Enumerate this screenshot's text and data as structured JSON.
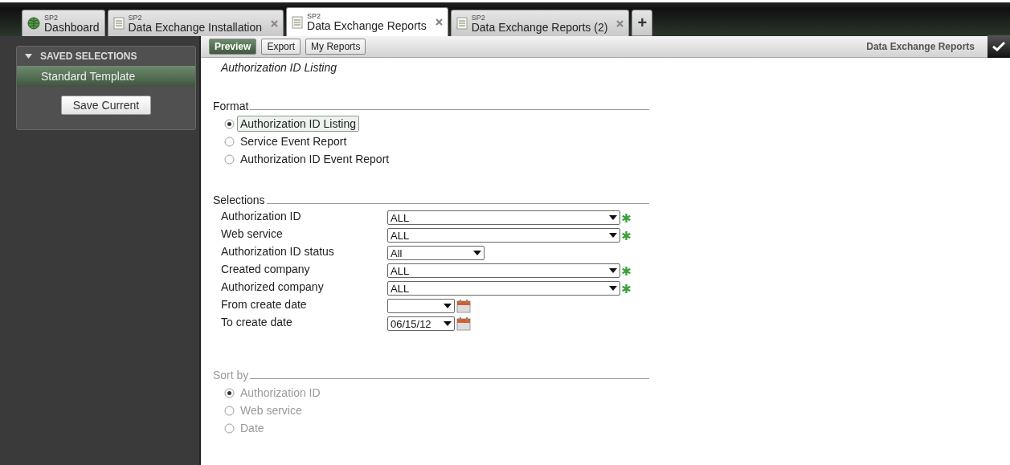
{
  "tabs": [
    {
      "app": "SP2",
      "label": "Dashboard",
      "kind": "globe",
      "closable": false,
      "selected": false
    },
    {
      "app": "SP2",
      "label": "Data Exchange Installation",
      "kind": "document",
      "closable": true,
      "selected": false
    },
    {
      "app": "SP2",
      "label": "Data Exchange Reports",
      "kind": "document",
      "closable": true,
      "selected": true
    },
    {
      "app": "SP2",
      "label": "Data Exchange Reports (2)",
      "kind": "document",
      "closable": true,
      "selected": false
    }
  ],
  "new_tab": "+",
  "sidebar": {
    "title": "SAVED SELECTIONS",
    "expanded": true,
    "items": [
      {
        "label": "Standard Template",
        "selected": true
      }
    ],
    "button": "Save Current"
  },
  "toolbar": {
    "buttons": [
      {
        "label": "Preview",
        "selected": true
      },
      {
        "label": "Export",
        "selected": false
      },
      {
        "label": "My Reports",
        "selected": false
      }
    ],
    "title": "Data Exchange Reports"
  },
  "report_title": "Authorization ID Listing",
  "format": {
    "legend": "Format",
    "disabled": false,
    "options": [
      {
        "label": "Authorization ID Listing",
        "selected": true
      },
      {
        "label": "Service Event Report",
        "selected": false
      },
      {
        "label": "Authorization ID Event Report",
        "selected": false
      }
    ]
  },
  "selections": {
    "legend": "Selections",
    "fields": [
      {
        "label": "Authorization ID",
        "value": "ALL",
        "kind": "wide",
        "required": true,
        "calendar": false
      },
      {
        "label": "Web service",
        "value": "ALL",
        "kind": "wide",
        "required": true,
        "calendar": false
      },
      {
        "label": "Authorization ID status",
        "value": "All",
        "kind": "narrow",
        "required": false,
        "calendar": false
      },
      {
        "label": "Created company",
        "value": "ALL",
        "kind": "wide",
        "required": true,
        "calendar": false
      },
      {
        "label": "Authorized company",
        "value": "ALL",
        "kind": "wide",
        "required": true,
        "calendar": false
      },
      {
        "label": "From create date",
        "kind": "date",
        "required": false,
        "calendar": true
      },
      {
        "label": "To create date",
        "value": "06/15/12",
        "kind": "date",
        "required": false,
        "calendar": true
      }
    ]
  },
  "sort_by": {
    "legend": "Sort by",
    "disabled": true,
    "options": [
      {
        "label": "Authorization ID",
        "selected": true
      },
      {
        "label": "Web service",
        "selected": false
      },
      {
        "label": "Date",
        "selected": false
      }
    ]
  }
}
